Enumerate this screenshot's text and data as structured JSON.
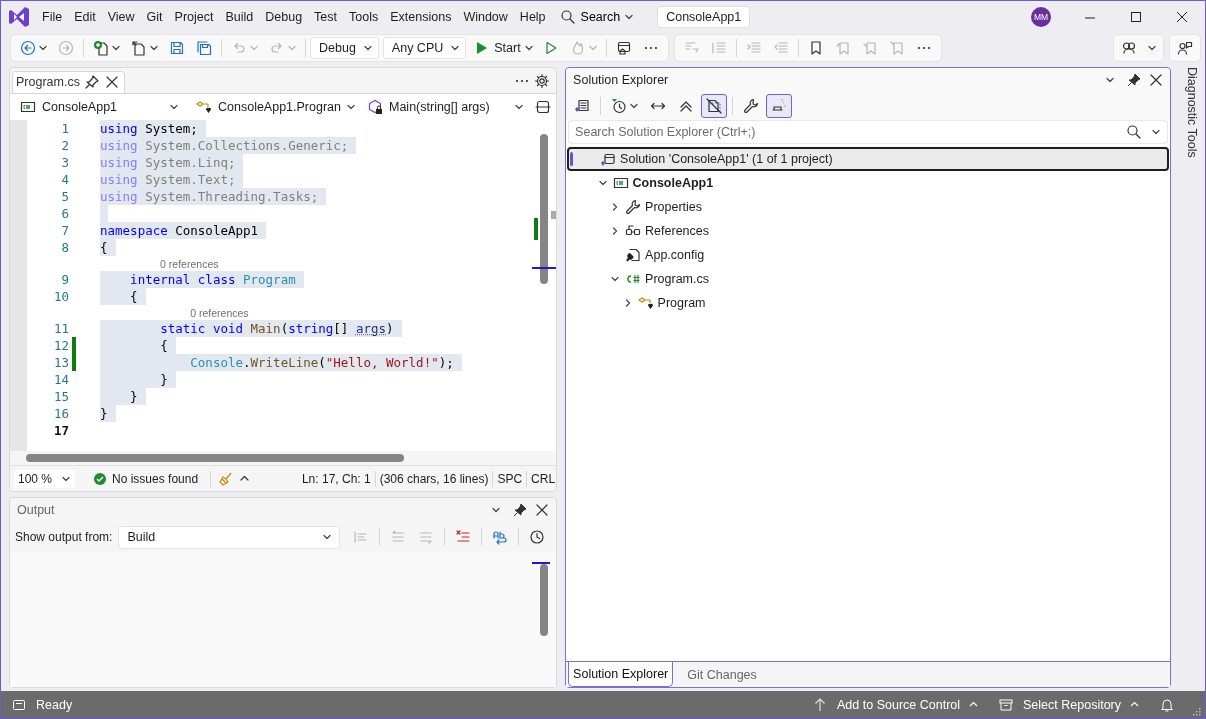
{
  "menu": [
    "File",
    "Edit",
    "View",
    "Git",
    "Project",
    "Build",
    "Debug",
    "Test",
    "Tools",
    "Extensions",
    "Window",
    "Help"
  ],
  "search": {
    "label": "Search"
  },
  "solution_name": "ConsoleApp1",
  "account": {
    "initials": "MM"
  },
  "toolbar": [
    {
      "kind": "icon",
      "disabled": false,
      "dropdown": true
    },
    {
      "kind": "icon",
      "disabled": true,
      "dropdown": false
    },
    {
      "kind": "separator"
    },
    {
      "kind": "icon",
      "disabled": false,
      "dropdown": true
    },
    {
      "kind": "icon",
      "disabled": false,
      "dropdown": true
    },
    {
      "kind": "icon",
      "disabled": false,
      "dropdown": false
    },
    {
      "kind": "icon",
      "disabled": false,
      "dropdown": false
    },
    {
      "kind": "separator"
    },
    {
      "kind": "icon",
      "disabled": true,
      "dropdown": true
    },
    {
      "kind": "icon",
      "disabled": true,
      "dropdown": true
    },
    {
      "kind": "separator"
    },
    {
      "kind": "combo",
      "text": "Debug"
    },
    {
      "kind": "combo",
      "text": "Any CPU"
    },
    {
      "kind": "run",
      "text": "Start"
    },
    {
      "kind": "icon",
      "disabled": false,
      "dropdown": false
    },
    {
      "kind": "icon",
      "disabled": true,
      "dropdown": true
    },
    {
      "kind": "separator"
    },
    {
      "kind": "icon",
      "disabled": false,
      "dropdown": false
    },
    {
      "kind": "more"
    }
  ],
  "edit_toolbar": [
    {
      "kind": "icon",
      "disabled": true
    },
    {
      "kind": "icon",
      "disabled": true
    },
    {
      "kind": "separator"
    },
    {
      "kind": "icon",
      "disabled": true
    },
    {
      "kind": "icon",
      "disabled": true
    },
    {
      "kind": "separator"
    },
    {
      "kind": "icon",
      "disabled": false
    },
    {
      "kind": "icon",
      "disabled": true
    },
    {
      "kind": "icon",
      "disabled": true
    },
    {
      "kind": "icon",
      "disabled": true
    },
    {
      "kind": "more"
    }
  ],
  "editor": {
    "tabs": [
      {
        "label": "Program.cs",
        "selected": true
      }
    ],
    "nav": [
      "ConsoleApp1",
      "ConsoleApp1.Progran",
      "Main(string[] args)"
    ],
    "lines": [
      {
        "number": "1",
        "selected": true,
        "changed": false,
        "current": false,
        "tokens": [
          {
            "kind": "keyword",
            "text": "using"
          },
          {
            "kind": "text",
            "text": " System;"
          }
        ]
      },
      {
        "number": "2",
        "selected": true,
        "changed": false,
        "current": false,
        "tokens": [
          {
            "kind": "keyword_faded",
            "text": "using"
          },
          {
            "kind": "text_faded",
            "text": " System.Collections.Generic;"
          }
        ]
      },
      {
        "number": "3",
        "selected": true,
        "changed": false,
        "current": false,
        "tokens": [
          {
            "kind": "keyword_faded",
            "text": "using"
          },
          {
            "kind": "text_faded",
            "text": " System.Linq;"
          }
        ]
      },
      {
        "number": "4",
        "selected": true,
        "changed": false,
        "current": false,
        "tokens": [
          {
            "kind": "keyword_faded",
            "text": "using"
          },
          {
            "kind": "text_faded",
            "text": " System.Text;"
          }
        ]
      },
      {
        "number": "5",
        "selected": true,
        "changed": false,
        "current": false,
        "tokens": [
          {
            "kind": "keyword_faded",
            "text": "using"
          },
          {
            "kind": "text_faded",
            "text": " System.Threading.Tasks;"
          }
        ]
      },
      {
        "number": "6",
        "selected": true,
        "changed": false,
        "current": false
      },
      {
        "number": "7",
        "selected": true,
        "changed": false,
        "current": false,
        "tokens": [
          {
            "kind": "keyword",
            "text": "namespace"
          },
          {
            "kind": "text",
            "text": " ConsoleApp1"
          }
        ]
      },
      {
        "number": "8",
        "selected": true,
        "changed": false,
        "current": false,
        "tokens": [
          {
            "kind": "text",
            "text": "{"
          }
        ]
      },
      {
        "number": "9",
        "selected": true,
        "changed": false,
        "current": false,
        "codelens": "0 references",
        "tokens": [
          {
            "kind": "keyword",
            "text": "    internal "
          },
          {
            "kind": "keyword",
            "text": "class "
          },
          {
            "kind": "type",
            "text": "Program"
          }
        ]
      },
      {
        "number": "10",
        "selected": true,
        "changed": false,
        "current": false,
        "tokens": [
          {
            "kind": "text",
            "text": "    {"
          }
        ]
      },
      {
        "number": "11",
        "selected": true,
        "changed": false,
        "current": false,
        "codelens": "0 references",
        "tokens": [
          {
            "kind": "keyword",
            "text": "        static "
          },
          {
            "kind": "keyword",
            "text": "void "
          },
          {
            "kind": "method",
            "text": "Main"
          },
          {
            "kind": "text",
            "text": "("
          },
          {
            "kind": "keyword",
            "text": "string"
          },
          {
            "kind": "text",
            "text": "[] "
          },
          {
            "kind": "param",
            "text": "args"
          },
          {
            "kind": "text",
            "text": ")"
          }
        ]
      },
      {
        "number": "12",
        "selected": true,
        "changed": true,
        "current": false,
        "tokens": [
          {
            "kind": "text",
            "text": "        {"
          }
        ]
      },
      {
        "number": "13",
        "selected": true,
        "changed": true,
        "current": false,
        "tokens": [
          {
            "kind": "type",
            "text": "            Console"
          },
          {
            "kind": "text",
            "text": "."
          },
          {
            "kind": "method",
            "text": "WriteLine"
          },
          {
            "kind": "text",
            "text": "("
          },
          {
            "kind": "string",
            "text": "\"Hello, World!\""
          },
          {
            "kind": "text",
            "text": ");"
          }
        ]
      },
      {
        "number": "14",
        "selected": true,
        "changed": false,
        "current": false,
        "tokens": [
          {
            "kind": "text",
            "text": "        }"
          }
        ]
      },
      {
        "number": "15",
        "selected": true,
        "changed": false,
        "current": false,
        "tokens": [
          {
            "kind": "text",
            "text": "    }"
          }
        ]
      },
      {
        "number": "16",
        "selected": true,
        "changed": false,
        "current": false,
        "tokens": [
          {
            "kind": "text",
            "text": "}"
          }
        ]
      },
      {
        "number": "17",
        "selected": false,
        "changed": false,
        "current": true
      }
    ],
    "status": {
      "zoom": "100 %",
      "issues": "No issues found",
      "position": "Ln: 17, Ch: 1",
      "stats": "(306 chars, 16 lines)",
      "indent": "SPC",
      "line_ending": "CRL"
    }
  },
  "output": {
    "title": "Output",
    "label": "Show output from:",
    "source": "Build",
    "toolbar": [
      {
        "disabled": true
      },
      {
        "disabled": true
      },
      {
        "disabled": true
      },
      {
        "disabled": false
      },
      {
        "disabled": false
      },
      {
        "disabled": false
      }
    ]
  },
  "solution_explorer": {
    "title": "Solution Explorer",
    "toolbar": [
      {
        "selected": false,
        "dropdown": false
      },
      {
        "selected": false,
        "dropdown": true
      },
      {
        "selected": false,
        "dropdown": false
      },
      {
        "selected": false,
        "dropdown": false
      },
      {
        "selected": true,
        "dropdown": false
      },
      {
        "selected": false,
        "dropdown": false
      },
      {
        "selected": true,
        "dropdown": false
      }
    ],
    "search": {
      "placeholder": "Search Solution Explorer (Ctrl+;)"
    },
    "tree": [
      {
        "kind": "solution",
        "label": "Solution 'ConsoleApp1' (1 of 1 project)",
        "selected": true,
        "children": [
          {
            "kind": "project",
            "label": "ConsoleApp1",
            "selected": false,
            "expanded": true,
            "children": [
              {
                "kind": "properties",
                "label": "Properties",
                "selected": false,
                "expanded": false
              },
              {
                "kind": "references",
                "label": "References",
                "selected": false,
                "expanded": false
              },
              {
                "kind": "config",
                "label": "App.config",
                "selected": false
              },
              {
                "kind": "csfile",
                "label": "Program.cs",
                "selected": false,
                "expanded": true,
                "children": [
                  {
                    "kind": "class",
                    "label": "Program",
                    "selected": false,
                    "expanded": false
                  }
                ]
              }
            ]
          }
        ]
      }
    ],
    "tabs": [
      {
        "label": "Solution Explorer",
        "selected": true
      },
      {
        "label": "Git Changes",
        "selected": false
      }
    ]
  },
  "side_tab": "Diagnostic Tools",
  "status_bar": {
    "message": "Ready",
    "items": [
      "Add to Source Control",
      "Select Repository"
    ]
  }
}
